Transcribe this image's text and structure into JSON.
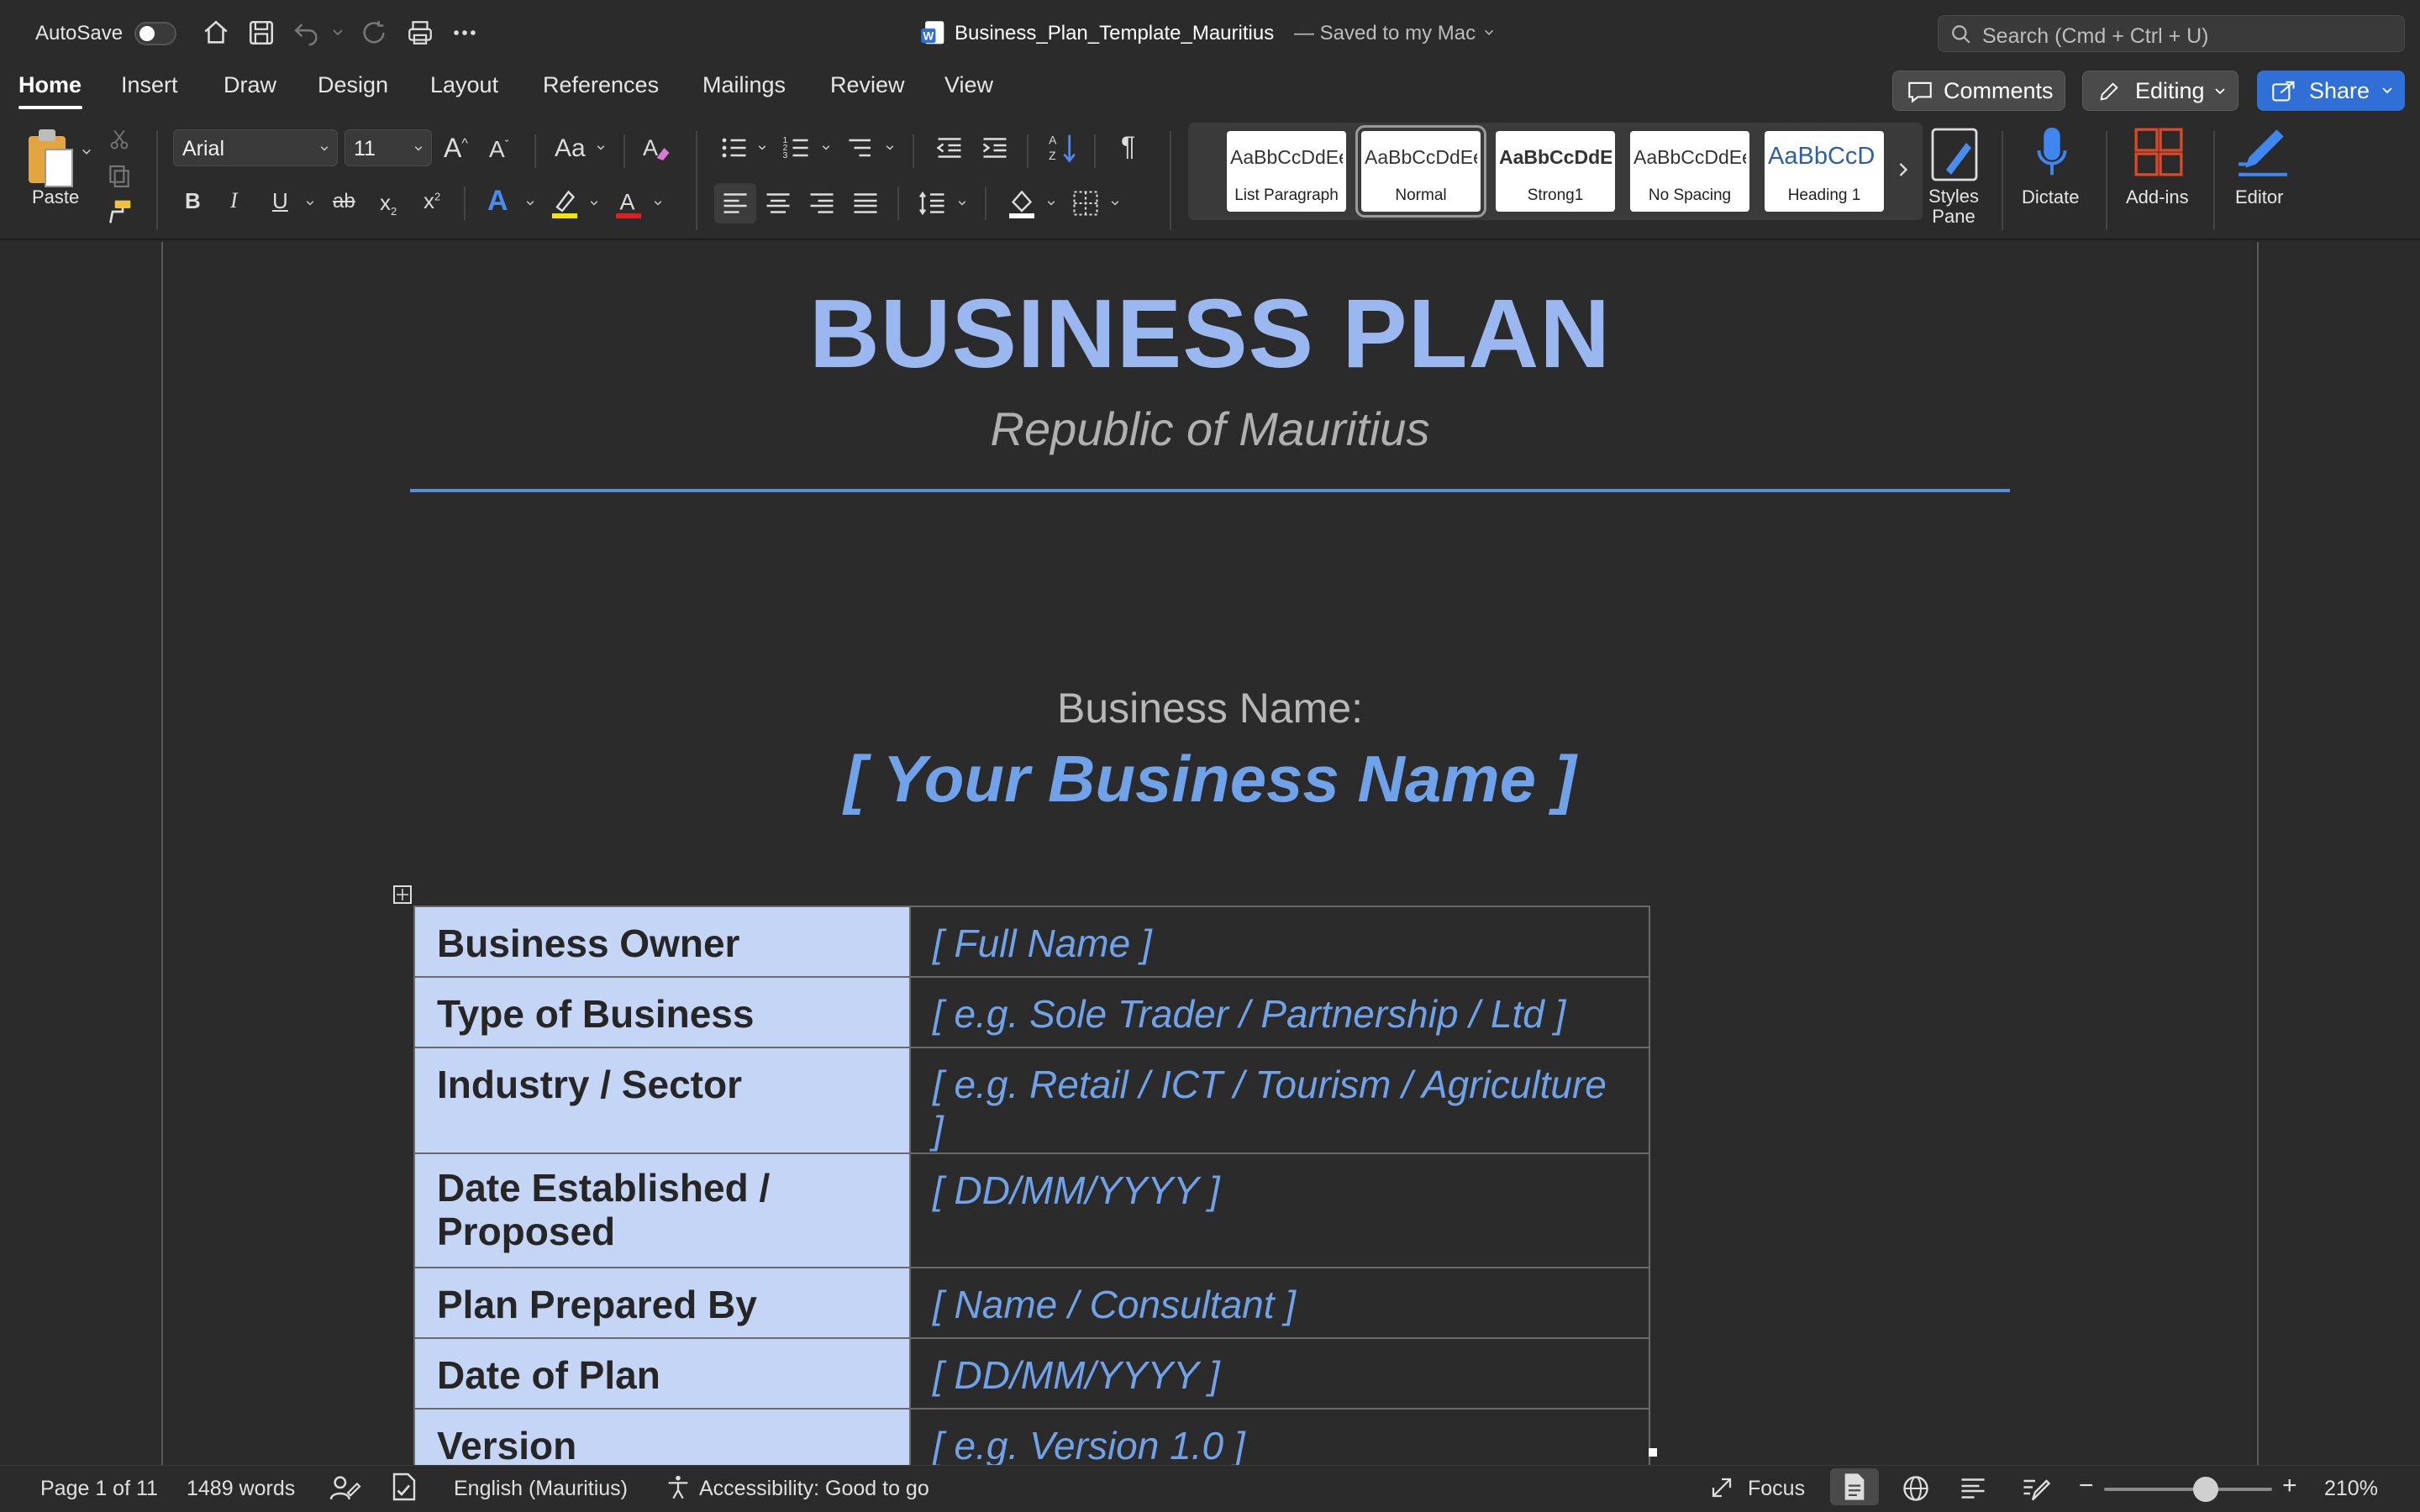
{
  "titlebar": {
    "autosave_label": "AutoSave",
    "doc_title": "Business_Plan_Template_Mauritius",
    "save_status": "— Saved to my Mac",
    "search_placeholder": "Search (Cmd + Ctrl + U)"
  },
  "tabs": [
    "Home",
    "Insert",
    "Draw",
    "Design",
    "Layout",
    "References",
    "Mailings",
    "Review",
    "View"
  ],
  "header_buttons": {
    "comments": "Comments",
    "editing": "Editing",
    "share": "Share"
  },
  "ribbon": {
    "paste_label": "Paste",
    "font_name": "Arial",
    "font_size": "11",
    "styles": [
      {
        "sample": "AaBbCcDdEe",
        "name": "List Paragraph"
      },
      {
        "sample": "AaBbCcDdEe",
        "name": "Normal"
      },
      {
        "sample": "AaBbCcDdE",
        "name": "Strong1"
      },
      {
        "sample": "AaBbCcDdEe",
        "name": "No Spacing"
      },
      {
        "sample": "AaBbCcD",
        "name": "Heading 1"
      }
    ],
    "styles_pane_label": "Styles Pane",
    "dictate_label": "Dictate",
    "addins_label": "Add-ins",
    "editor_label": "Editor"
  },
  "document": {
    "title": "BUSINESS PLAN",
    "subtitle": "Republic of Mauritius",
    "business_name_label": "Business Name:",
    "business_name_value": "[ Your Business Name ]",
    "table": [
      {
        "key": "Business Owner",
        "value": "[ Full Name ]"
      },
      {
        "key": "Type of Business",
        "value": "[ e.g. Sole Trader / Partnership / Ltd ]"
      },
      {
        "key": "Industry / Sector",
        "value": "[ e.g. Retail / ICT / Tourism / Agriculture ]"
      },
      {
        "key": "Date Established / Proposed",
        "value": "[ DD/MM/YYYY ]"
      },
      {
        "key": "Plan Prepared By",
        "value": "[ Name / Consultant ]"
      },
      {
        "key": "Date of Plan",
        "value": "[ DD/MM/YYYY ]"
      },
      {
        "key": "Version",
        "value": "[ e.g. Version 1.0 ]"
      }
    ]
  },
  "statusbar": {
    "page": "Page 1 of 11",
    "words": "1489 words",
    "language": "English (Mauritius)",
    "accessibility": "Accessibility: Good to go",
    "focus": "Focus",
    "zoom": "210%"
  },
  "colors": {
    "accent": "#2f6fd6",
    "title_blue": "#9ab7f0",
    "placeholder_blue": "#6fa2e8",
    "table_key_bg": "#c5d5f6"
  }
}
